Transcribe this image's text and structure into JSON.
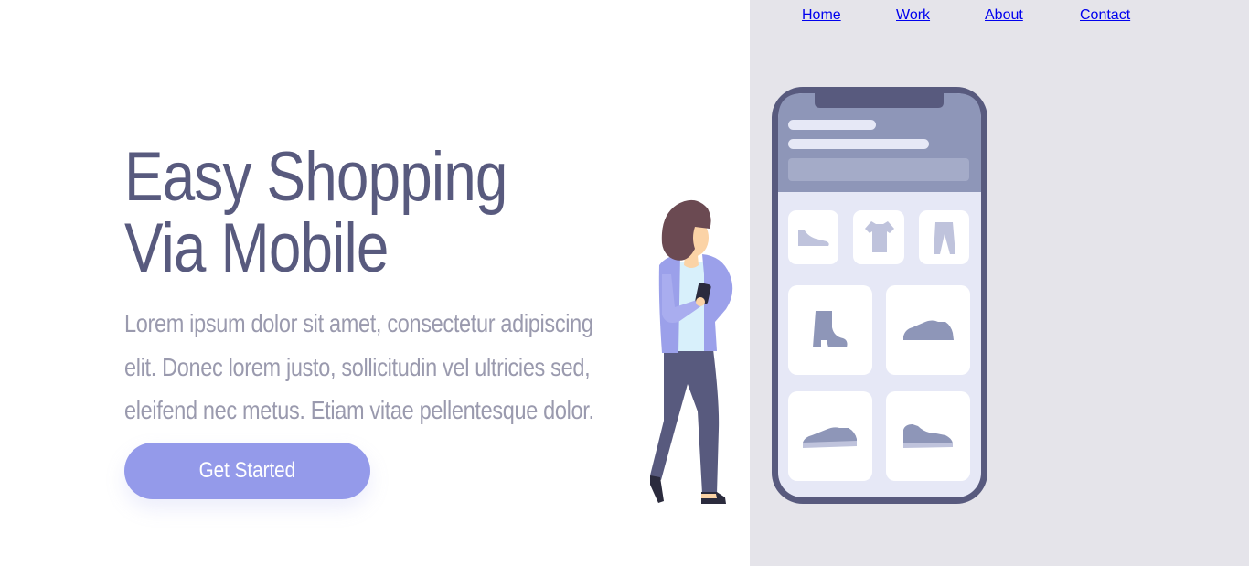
{
  "nav": {
    "items": [
      {
        "label": "Home",
        "state": "default"
      },
      {
        "label": "Work",
        "state": "muted"
      },
      {
        "label": "About",
        "state": "default"
      },
      {
        "label": "Contact",
        "state": "default"
      }
    ]
  },
  "hero": {
    "title_line1": "Easy Shopping",
    "title_line2": "Via Mobile",
    "body": "Lorem ipsum dolor sit amet, consectetur adipiscing elit. Donec lorem justo, sollicitudin vel ultricies sed, eleifend nec metus. Etiam vitae pellentesque dolor.",
    "cta_label": "Get Started"
  },
  "illustration": {
    "phone_items": [
      "flat-shoe-icon",
      "tshirt-icon",
      "pants-icon",
      "boot-icon",
      "sneaker-icon",
      "sneaker-low-icon",
      "sneaker-icon"
    ]
  },
  "colors": {
    "primary": "#585a7e",
    "accent": "#949aea",
    "muted_text": "#9a9aae",
    "panel_bg": "#e5e4ea"
  }
}
